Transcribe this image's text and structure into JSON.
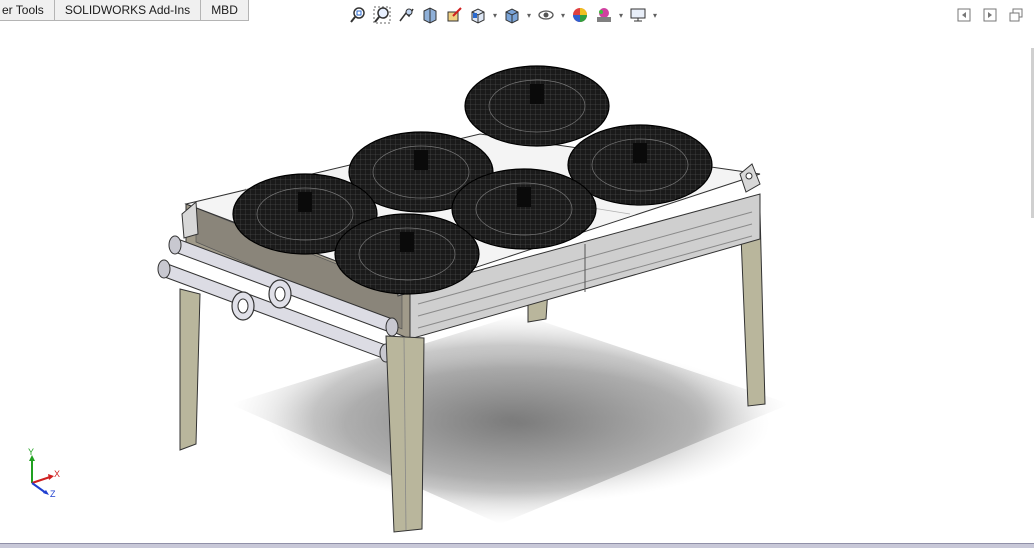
{
  "command_tabs": [
    {
      "label": "er Tools"
    },
    {
      "label": "SOLIDWORKS Add-Ins"
    },
    {
      "label": "MBD"
    }
  ],
  "heads_up_toolbar": {
    "tools": [
      "zoom-to-fit-icon",
      "zoom-to-area-icon",
      "previous-view-icon",
      "section-view-icon",
      "dynamic-annotation-icon",
      "view-orientation-icon",
      "display-style-icon",
      "hide-show-items-icon",
      "edit-appearance-icon",
      "apply-scene-icon",
      "view-settings-icon"
    ]
  },
  "triad": {
    "y": "Y",
    "x": "X",
    "z": "Z"
  },
  "colors": {
    "frame_olive": "#b9b69c",
    "panel_gray": "#c8c8c8",
    "top_white": "#f4f4f4",
    "fan_black": "#141414",
    "triad_x": "#d02020",
    "triad_y": "#20a020",
    "triad_z": "#2040d0"
  }
}
